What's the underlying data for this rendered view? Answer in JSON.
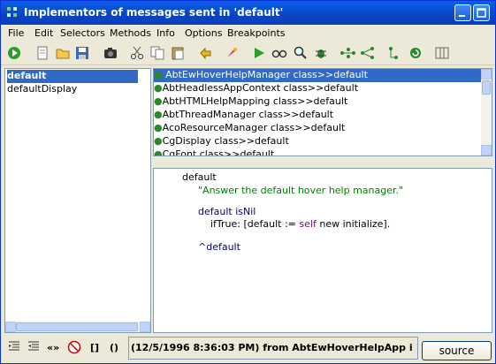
{
  "window": {
    "title": "Implementors of messages sent in 'default'"
  },
  "menu": [
    "File",
    "Edit",
    "Selectors",
    "Methods",
    "Info",
    "Options",
    "Breakpoints"
  ],
  "selectors": [
    {
      "label": "default",
      "selected": true
    },
    {
      "label": "defaultDisplay",
      "selected": false
    }
  ],
  "implementors": [
    {
      "label": "AbtEwHoverHelpManager class>>default",
      "selected": true
    },
    {
      "label": "AbtHeadlessAppContext class>>default",
      "selected": false
    },
    {
      "label": "AbtHTMLHelpMapping class>>default",
      "selected": false
    },
    {
      "label": "AbtThreadManager class>>default",
      "selected": false
    },
    {
      "label": "AcoResourceManager class>>default",
      "selected": false
    },
    {
      "label": "CgDisplay class>>default",
      "selected": false
    },
    {
      "label": "CgFont class>>default",
      "selected": false
    }
  ],
  "source": {
    "selector": "default",
    "comment": "\"Answer the default hover help manager.\"",
    "line3_keyword": "default",
    "line3_rest": "isNil",
    "line4_a": "ifTrue: [default := ",
    "line4_self": "self",
    "line4_b": " new initialize].",
    "line5": "^default"
  },
  "status": {
    "text": "(12/5/1996 8:36:03 PM) from AbtEwHoverHelpApp i"
  },
  "buttons": {
    "source": "source",
    "brackets": "[]",
    "parens": "()"
  },
  "colors": {
    "accent": "#316ac5",
    "comment": "#008000",
    "keyword": "#000080",
    "self": "#800080"
  }
}
